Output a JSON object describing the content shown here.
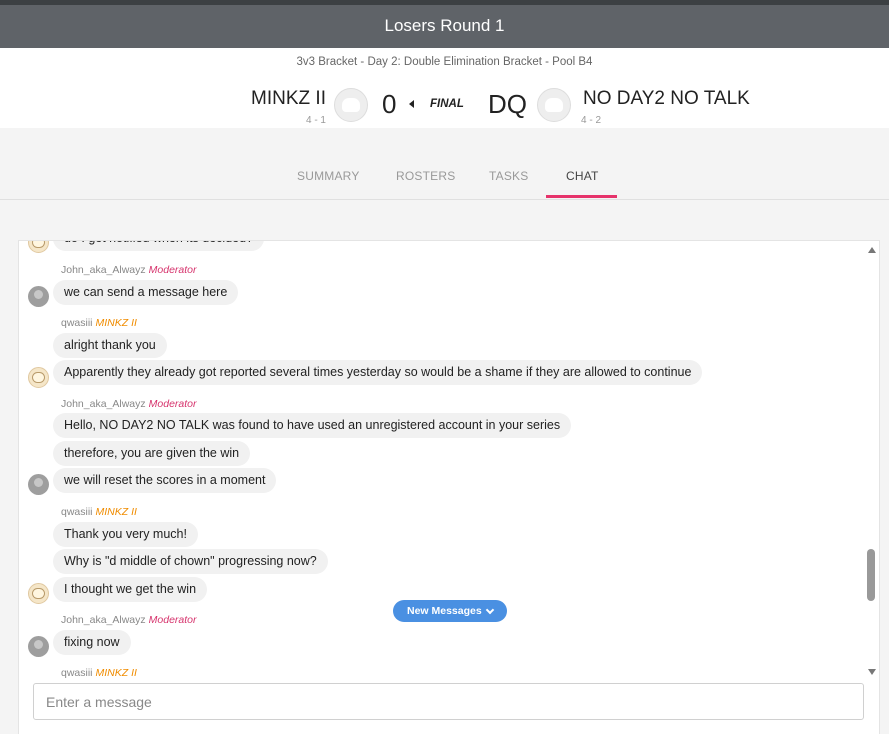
{
  "header": {
    "title": "Losers Round 1",
    "bracket": "3v3 Bracket - Day 2: Double Elimination Bracket - Pool B4",
    "team_left": {
      "name": "MINKZ II",
      "record": "4 - 1",
      "score": "0"
    },
    "status": "FINAL",
    "team_right": {
      "name": "NO DAY2 NO TALK",
      "record": "4 - 2",
      "score": "DQ"
    }
  },
  "tabs": [
    {
      "label": "SUMMARY",
      "active": false
    },
    {
      "label": "ROSTERS",
      "active": false
    },
    {
      "label": "TASKS",
      "active": false
    },
    {
      "label": "CHAT",
      "active": true
    }
  ],
  "chat": {
    "messages": {
      "m0": {
        "text": "do I get notified when its decided?"
      },
      "g1": {
        "author": "John_aka_Alwayz",
        "role": "Moderator",
        "lines": [
          "we can send a message here"
        ]
      },
      "g2": {
        "author": "qwasiii",
        "role": "MINKZ II",
        "lines": [
          "alright thank you",
          "Apparently they already got reported several times yesterday so would be a shame if they are allowed to continue"
        ]
      },
      "g3": {
        "author": "John_aka_Alwayz",
        "role": "Moderator",
        "lines": [
          "Hello, NO DAY2 NO TALK was found to have used an unregistered account in your series",
          "therefore, you are given the win",
          "we will reset the scores in a moment"
        ]
      },
      "g4": {
        "author": "qwasiii",
        "role": "MINKZ II",
        "lines": [
          "Thank you very much!",
          "Why is \"d middle of chown\" progressing now?",
          "I thought we get the win"
        ]
      },
      "g5": {
        "author": "John_aka_Alwayz",
        "role": "Moderator",
        "lines": [
          "fixing now"
        ]
      },
      "g6": {
        "author": "qwasiii",
        "role": "MINKZ II"
      }
    },
    "new_messages_label": "New Messages",
    "input_placeholder": "Enter a message"
  },
  "colors": {
    "topbar": "#5f6368",
    "accent_tab": "#e6336b",
    "moderator": "#d6336c",
    "team_role": "#f08c00",
    "new_messages_button": "#4a90e2"
  }
}
